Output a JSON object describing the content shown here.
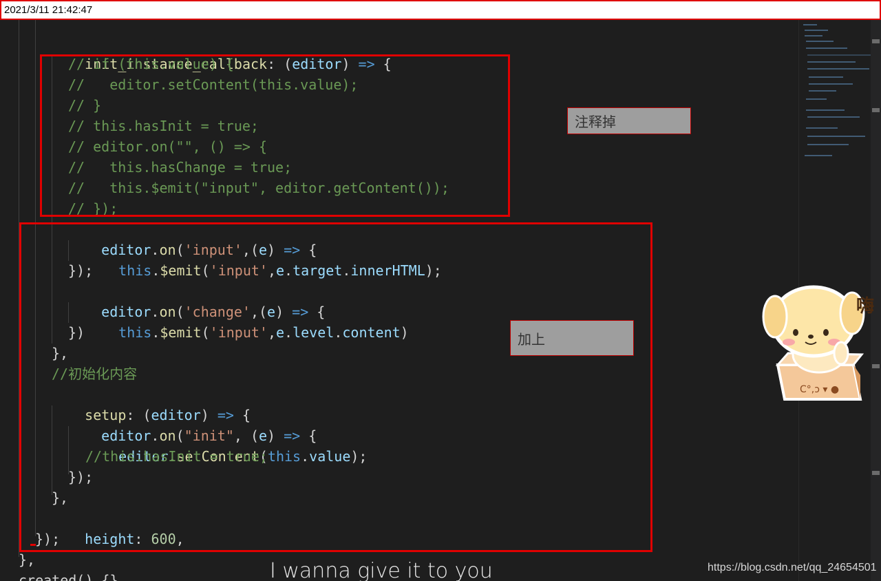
{
  "timestamp": "2021/3/11 21:42:47",
  "notes": {
    "comment_out": "注释掉",
    "add": "加上"
  },
  "sticker_text": "嗨",
  "subtitle": "I wanna give it to you",
  "watermark": "https://blog.csdn.net/qq_24654501",
  "colors": {
    "highlight_box": "#e00000",
    "comment": "#6a9955",
    "property": "#9cdcfe",
    "keyword": "#569cd6",
    "string": "#ce9178",
    "number": "#b5cea8",
    "function": "#dcdcaa"
  },
  "code": {
    "l1": [
      "init_instance_callback",
      ": (",
      "editor",
      ") ",
      "=>",
      " {"
    ],
    "l2": "// if (this.value) {",
    "l3": "//   editor.setContent(this.value);",
    "l4": "// }",
    "l5": "// this.hasInit = true;",
    "l6": "// editor.on(\"\", () => {",
    "l7": "//   this.hasChange = true;",
    "l8": "//   this.$emit(\"input\", editor.getContent());",
    "l9": "// });",
    "l10": [
      "editor",
      ".",
      "on",
      "(",
      "'input'",
      ",(",
      "e",
      ") ",
      "=>",
      " {"
    ],
    "l11": [
      "this",
      ".",
      "$emit",
      "(",
      "'input'",
      ",",
      "e",
      ".",
      "target",
      ".",
      "innerHTML",
      ");"
    ],
    "l12": "});",
    "l13": [
      "editor",
      ".",
      "on",
      "(",
      "'change'",
      ",(",
      "e",
      ") ",
      "=>",
      " {"
    ],
    "l14": [
      "this",
      ".",
      "$emit",
      "(",
      "'input'",
      ",",
      "e",
      ".",
      "level",
      ".",
      "content",
      ")"
    ],
    "l15": "})",
    "l16": "},",
    "l17": "//初始化内容",
    "l18": [
      "setup",
      ": (",
      "editor",
      ") ",
      "=>",
      " {"
    ],
    "l19": [
      "editor",
      ".",
      "on",
      "(",
      "\"init\"",
      ", (",
      "e",
      ") ",
      "=>",
      " {"
    ],
    "l20": [
      "editor",
      ".",
      "setContent",
      "(",
      "this",
      ".",
      "value",
      ");"
    ],
    "l21": "//this.hasInit = true;",
    "l22": "});",
    "l23": "},",
    "l24": [
      "height",
      ": ",
      "600",
      ","
    ],
    "l25": "});",
    "l26": "},",
    "l27": "created() {},"
  }
}
